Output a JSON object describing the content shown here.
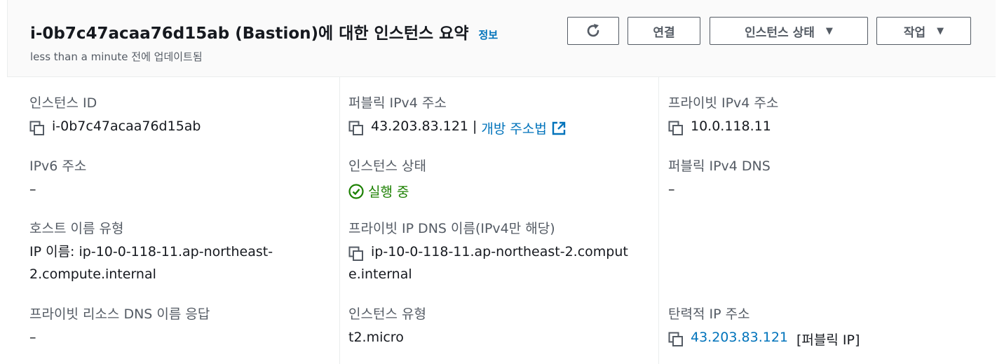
{
  "header": {
    "title": "i-0b7c47acaa76d15ab (Bastion)에 대한 인스턴스 요약",
    "info_label": "정보",
    "updated": "less than a minute 전에 업데이트됨",
    "buttons": {
      "refresh_icon": "refresh-icon",
      "connect": "연결",
      "instance_state": "인스턴스 상태",
      "actions": "작업"
    }
  },
  "summary": {
    "instance_id": {
      "label": "인스턴스 ID",
      "value": "i-0b7c47acaa76d15ab"
    },
    "public_ipv4": {
      "label": "퍼블릭 IPv4 주소",
      "value": "43.203.83.121",
      "separator": "|",
      "link": "개방 주소법"
    },
    "private_ipv4": {
      "label": "프라이빗 IPv4 주소",
      "value": "10.0.118.11"
    },
    "ipv6": {
      "label": "IPv6 주소",
      "value": "–"
    },
    "instance_state": {
      "label": "인스턴스 상태",
      "value": "실행 중"
    },
    "public_dns": {
      "label": "퍼블릭 IPv4 DNS",
      "value": "–"
    },
    "hostname_type": {
      "label": "호스트 이름 유형",
      "line1": "IP 이름: ip-10-0-118-11.ap-northeast-",
      "line2": "2.compute.internal"
    },
    "private_dns": {
      "label": "프라이빗 IP DNS 이름(IPv4만 해당)",
      "line1": "ip-10-0-118-11.ap-northeast-2.comput",
      "line2": "e.internal"
    },
    "private_resource_dns": {
      "label": "프라이빗 리소스 DNS 이름 응답",
      "value": "–"
    },
    "instance_type": {
      "label": "인스턴스 유형",
      "value": "t2.micro"
    },
    "elastic_ip": {
      "label": "탄력적 IP 주소",
      "value": "43.203.83.121",
      "suffix": "[퍼블릭 IP]"
    }
  },
  "colors": {
    "link": "#0073bb",
    "success": "#1d8102",
    "label": "#545b64"
  }
}
